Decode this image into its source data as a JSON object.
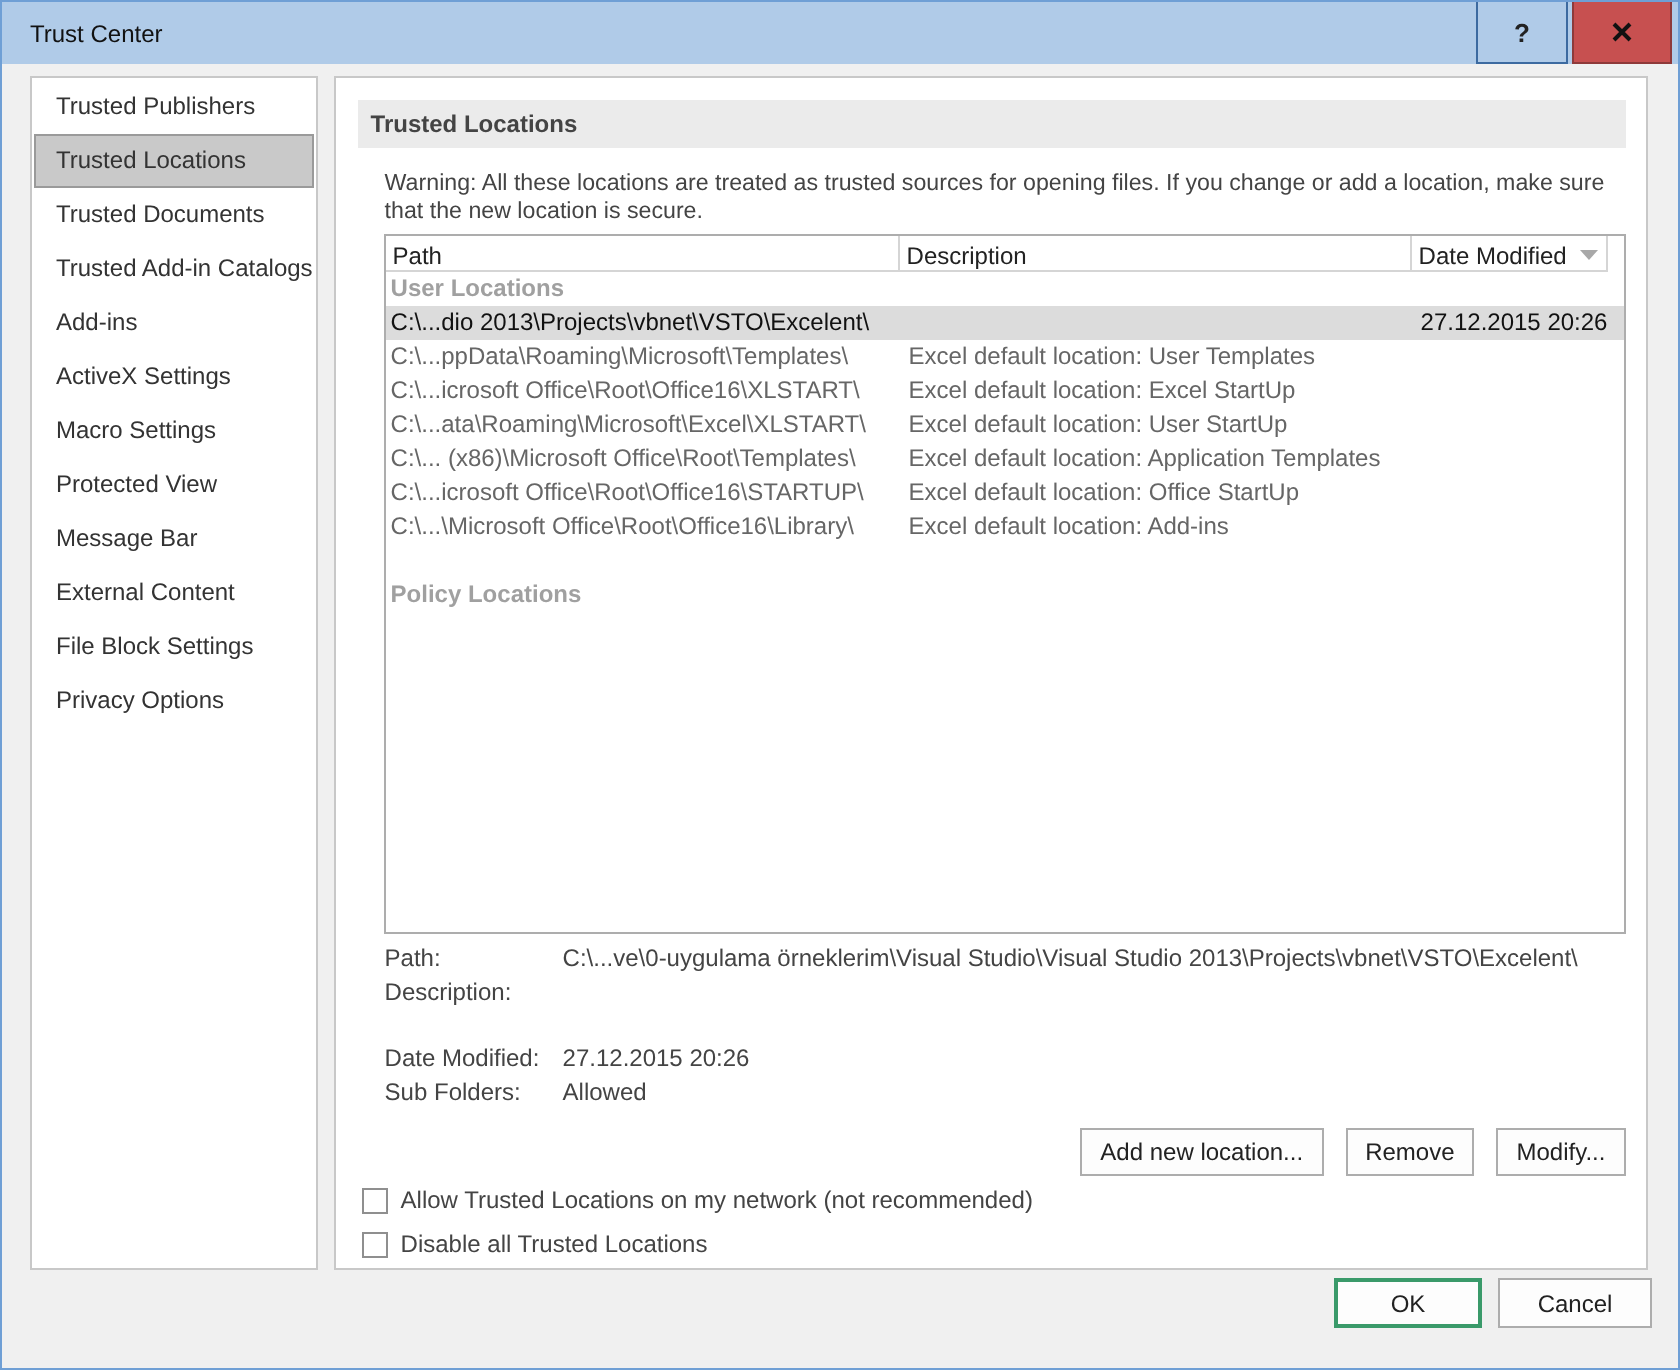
{
  "window": {
    "title": "Trust Center",
    "help": "?"
  },
  "sidebar": {
    "items": [
      {
        "label": "Trusted Publishers",
        "selected": false
      },
      {
        "label": "Trusted Locations",
        "selected": true
      },
      {
        "label": "Trusted Documents",
        "selected": false
      },
      {
        "label": "Trusted Add-in Catalogs",
        "selected": false
      },
      {
        "label": "Add-ins",
        "selected": false
      },
      {
        "label": "ActiveX Settings",
        "selected": false
      },
      {
        "label": "Macro Settings",
        "selected": false
      },
      {
        "label": "Protected View",
        "selected": false
      },
      {
        "label": "Message Bar",
        "selected": false
      },
      {
        "label": "External Content",
        "selected": false
      },
      {
        "label": "File Block Settings",
        "selected": false
      },
      {
        "label": "Privacy Options",
        "selected": false
      }
    ]
  },
  "section": {
    "title": "Trusted Locations",
    "warning": "Warning: All these locations are treated as trusted sources for opening files.  If you change or add a location, make sure that the new location is secure."
  },
  "table": {
    "columns": [
      {
        "label": "Path",
        "sort_indicator": false
      },
      {
        "label": "Description",
        "sort_indicator": false
      },
      {
        "label": "Date Modified",
        "sort_indicator": true
      }
    ],
    "groups": [
      {
        "label": "User Locations",
        "rows": [
          {
            "path": "C:\\...dio 2013\\Projects\\vbnet\\VSTO\\Excelent\\",
            "date": "27.12.2015 20:26",
            "selected": true
          },
          {
            "path": "C:\\...ppData\\Roaming\\Microsoft\\Templates\\",
            "description": "Excel default location: User Templates",
            "selected": false
          },
          {
            "path": "C:\\...icrosoft Office\\Root\\Office16\\XLSTART\\",
            "description": "Excel default location: Excel StartUp",
            "selected": false
          },
          {
            "path": "C:\\...ata\\Roaming\\Microsoft\\Excel\\XLSTART\\",
            "description": "Excel default location: User StartUp",
            "selected": false
          },
          {
            "path": "C:\\... (x86)\\Microsoft Office\\Root\\Templates\\",
            "description": "Excel default location: Application Templates",
            "selected": false
          },
          {
            "path": "C:\\...icrosoft Office\\Root\\Office16\\STARTUP\\",
            "description": "Excel default location: Office StartUp",
            "selected": false
          },
          {
            "path": "C:\\...\\Microsoft Office\\Root\\Office16\\Library\\",
            "description": "Excel default location: Add-ins",
            "selected": false
          }
        ]
      },
      {
        "label": "Policy Locations"
      }
    ]
  },
  "details": [
    {
      "label": "Path:",
      "value": "C:\\...ve\\0-uygulama örneklerim\\Visual Studio\\Visual Studio 2013\\Projects\\vbnet\\VSTO\\Excelent\\"
    },
    {
      "label": "Description:"
    },
    {
      "label": "Date Modified:",
      "value": "27.12.2015 20:26"
    },
    {
      "label": "Sub Folders:",
      "value": "Allowed"
    }
  ],
  "actions": [
    "Add new location...",
    "Remove",
    "Modify..."
  ],
  "options": [
    {
      "label": "Allow Trusted Locations on my network (not recommended)",
      "checked": false
    },
    {
      "label": "Disable all Trusted Locations",
      "checked": false
    }
  ],
  "footer": [
    {
      "label": "OK",
      "default": true
    },
    {
      "label": "Cancel",
      "default": false
    }
  ]
}
